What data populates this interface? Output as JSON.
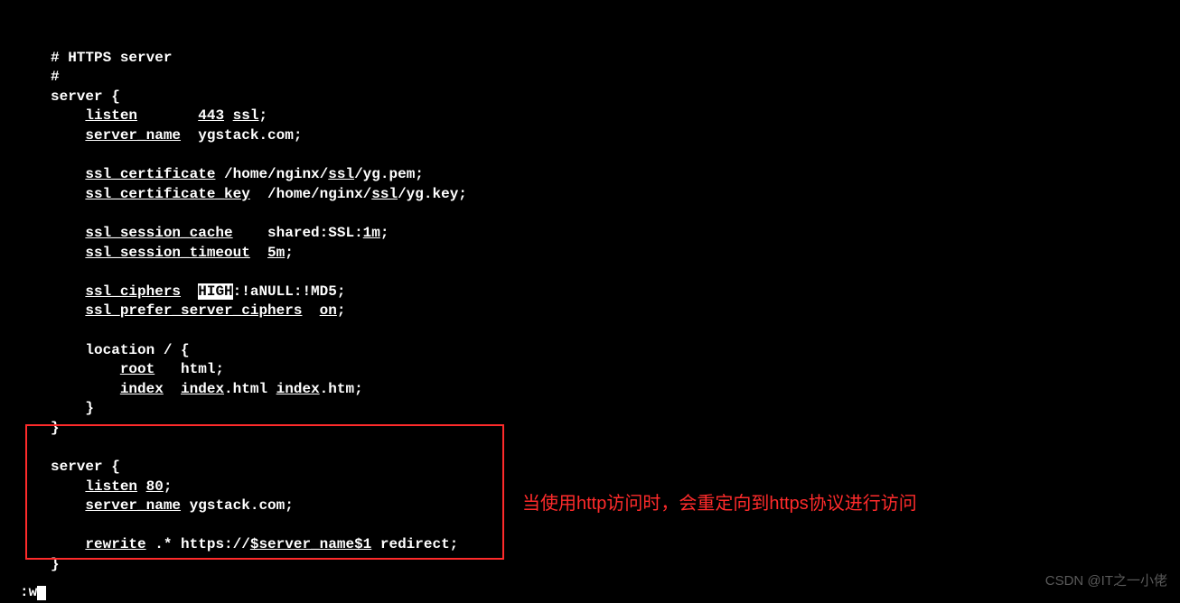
{
  "cfg": {
    "c1": "# HTTPS server",
    "c2": "#",
    "server_open": "server {",
    "listen_k": "listen",
    "listen_port": "443",
    "listen_ssl": "ssl",
    "server_name_k": "server_name",
    "server_name_v": "  ygstack.com;",
    "ssl_cert_k": "ssl_certificate",
    "ssl_cert_pre": " /home/nginx/",
    "ssl_dir": "ssl",
    "ssl_cert_post": "/yg.pem;",
    "ssl_cert_key_k": "ssl_certificate_key",
    "ssl_cert_key_pre": "  /home/nginx/",
    "ssl_cert_key_post": "/yg.key;",
    "ssl_session_cache_k": "ssl_session_cache",
    "ssl_session_cache_v": "    shared:SSL:",
    "ssl_session_cache_time": "1m",
    "ssl_session_timeout_k": "ssl_session_timeout",
    "ssl_session_timeout_v": "5m",
    "ssl_ciphers_k": "ssl_ciphers",
    "ssl_ciphers_high": "HIGH",
    "ssl_ciphers_rest": ":!aNULL:!MD5;",
    "ssl_prefer_k": "ssl_prefer_server_ciphers",
    "on": "on",
    "location_line": "location / {",
    "root_k": "root",
    "root_v": "   html;",
    "index_k": "index",
    "index_v1": "index",
    "index_v1_ext": ".html ",
    "index_v2": "index",
    "index_v2_ext": ".htm;",
    "close_inner": "}",
    "close_server": "}",
    "server2_open": "server {",
    "listen2_k": "listen",
    "listen2_port": "80",
    "server_name2_v": " ygstack.com;",
    "rewrite_k": "rewrite",
    "rewrite_pre": " .* https://",
    "rewrite_var": "$server_name$1",
    "rewrite_post": " redirect;",
    "close_server2": "}"
  },
  "annotation": "当使用http访问时，会重定向到https协议进行访问",
  "watermark": "CSDN @IT之一小佬",
  "statusline": ":w"
}
